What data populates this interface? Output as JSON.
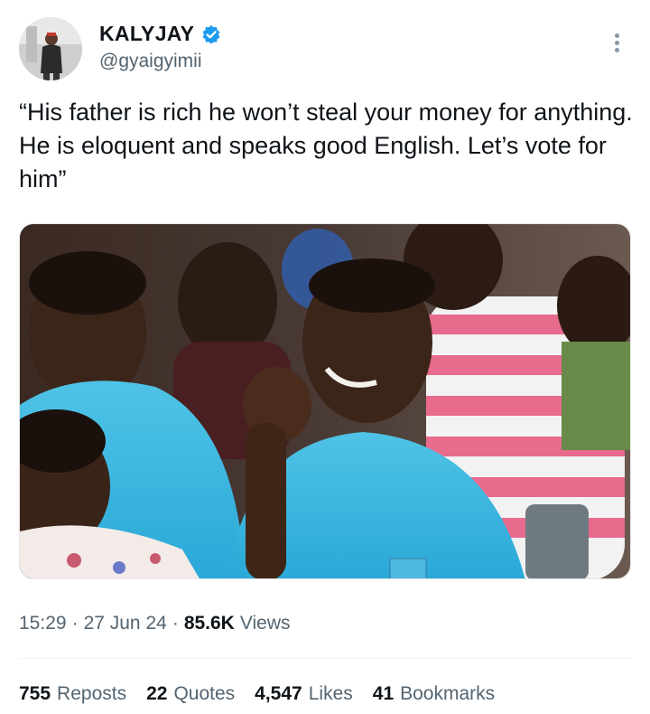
{
  "author": {
    "display_name": "KALYJAY",
    "handle": "@gyaigyimii",
    "verified_icon": "verified-badge-icon"
  },
  "tweet": {
    "text": "“His father is rich he won’t steal your money for anything. He is eloquent and speaks good English. Let’s vote for him”"
  },
  "meta": {
    "time": "15:29",
    "separator": "·",
    "date": "27 Jun 24",
    "views_count": "85.6K",
    "views_label": "Views"
  },
  "stats": {
    "reposts_count": "755",
    "reposts_label": "Reposts",
    "quotes_count": "22",
    "quotes_label": "Quotes",
    "likes_count": "4,547",
    "likes_label": "Likes",
    "bookmarks_count": "41",
    "bookmarks_label": "Bookmarks"
  },
  "colors": {
    "text_primary": "#0f1419",
    "text_secondary": "#536471",
    "verified_blue": "#1d9bf0"
  }
}
